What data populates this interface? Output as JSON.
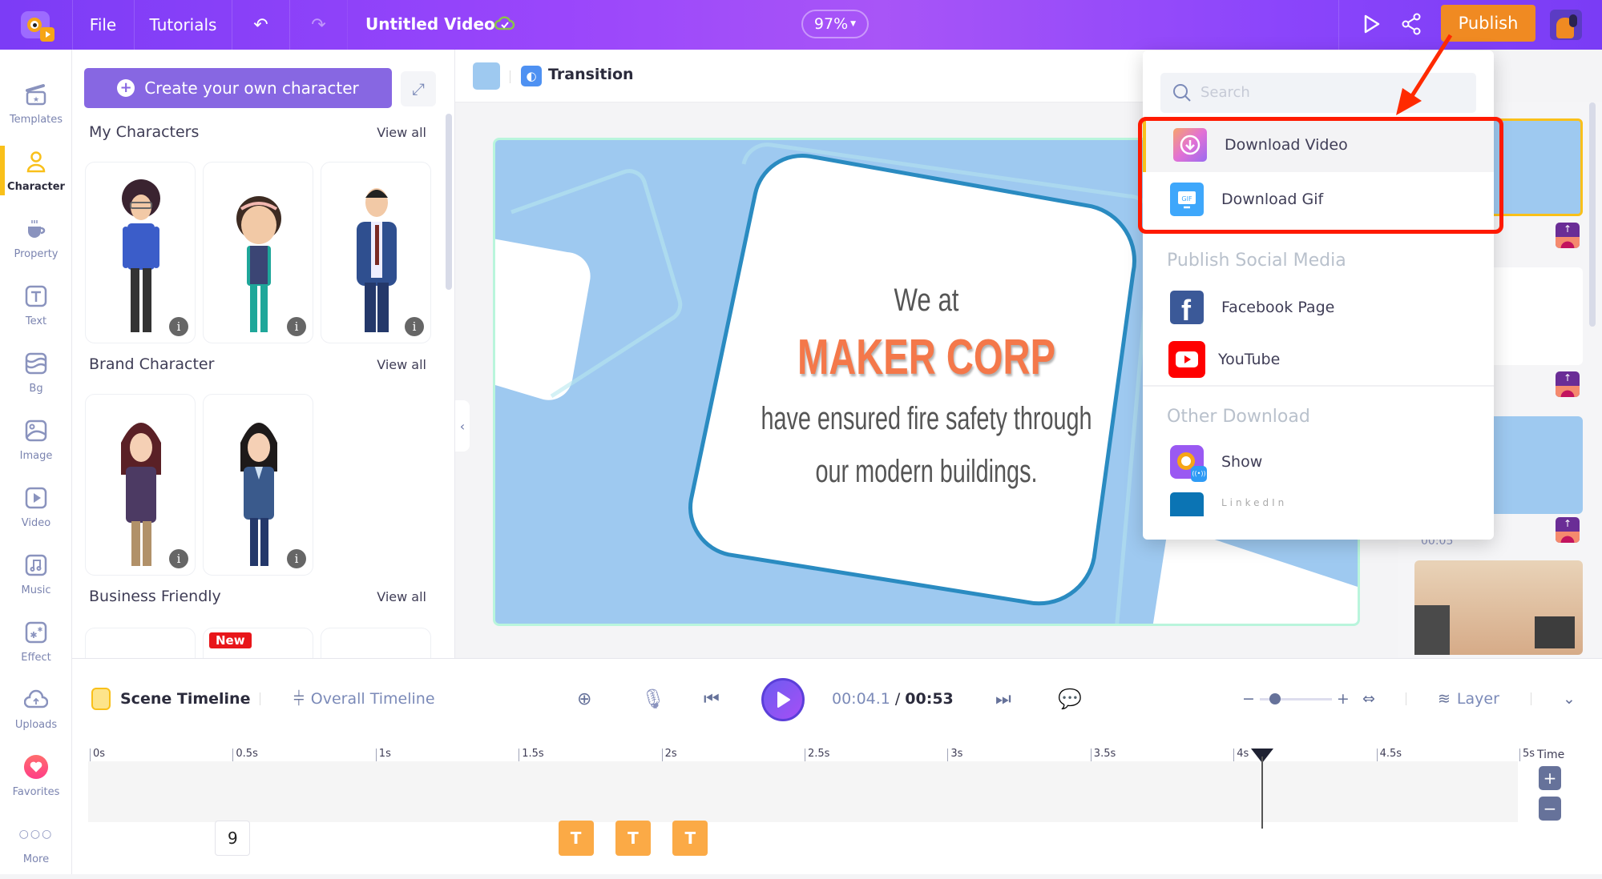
{
  "topbar": {
    "menu": [
      "File",
      "Tutorials"
    ],
    "title": "Untitled Video",
    "zoom": "97%",
    "publish_label": "Publish",
    "icons": {
      "undo": "undo-icon",
      "redo": "redo-icon",
      "cloud": "cloud-saved-icon",
      "preview": "play-preview-icon",
      "share": "share-icon"
    }
  },
  "rail": {
    "items": [
      {
        "label": "Templates",
        "icon": "clapperboard-icon"
      },
      {
        "label": "Character",
        "icon": "person-icon",
        "active": true
      },
      {
        "label": "Property",
        "icon": "cup-icon"
      },
      {
        "label": "Text",
        "icon": "text-icon"
      },
      {
        "label": "Bg",
        "icon": "layers-wave-icon"
      },
      {
        "label": "Image",
        "icon": "image-icon"
      },
      {
        "label": "Video",
        "icon": "video-icon"
      },
      {
        "label": "Music",
        "icon": "music-icon"
      },
      {
        "label": "Effect",
        "icon": "sparkle-icon"
      },
      {
        "label": "Uploads",
        "icon": "cloud-upload-icon"
      },
      {
        "label": "Favorites",
        "icon": "heart-icon"
      },
      {
        "label": "More",
        "icon": "more-dots-icon"
      }
    ],
    "accent": "#f9c01a"
  },
  "panel": {
    "create_label": "Create your own character",
    "sections": [
      {
        "title": "My Characters",
        "view_all": "View all"
      },
      {
        "title": "Brand Character",
        "view_all": "View all"
      },
      {
        "title": "Business Friendly",
        "view_all": "View all"
      }
    ],
    "new_badge": "New",
    "info_glyph": "i"
  },
  "canvas": {
    "transition_label": "Transition",
    "text_line1": "We at",
    "text_brand": "MAKER CORP",
    "text_line2": "have ensured fire safety through",
    "text_line3": "our modern buildings.",
    "brand_color": "#f4784a",
    "bg_color": "#9ec9f0"
  },
  "scenes": {
    "time_label": "00:05"
  },
  "dropdown": {
    "search_placeholder": "Search",
    "items_top": [
      {
        "label": "Download Video",
        "icon": "download-video-icon"
      },
      {
        "label": "Download Gif",
        "icon": "gif-icon"
      }
    ],
    "social_header": "Publish Social Media",
    "social": [
      {
        "label": "Facebook Page",
        "icon": "facebook-icon"
      },
      {
        "label": "YouTube",
        "icon": "youtube-icon"
      }
    ],
    "other_header": "Other Download",
    "other": [
      {
        "label": "Show",
        "icon": "show-app-icon"
      },
      {
        "label": "LinkedIn",
        "icon": "linkedin-icon"
      }
    ]
  },
  "timeline": {
    "scene_tab": "Scene Timeline",
    "overall_tab": "Overall Timeline",
    "current_time": "00:04.1",
    "separator": "/",
    "total_time": "00:53",
    "layer_label": "Layer",
    "time_label": "Time",
    "ticks": [
      "0s",
      "0.5s",
      "1s",
      "1.5s",
      "2s",
      "2.5s",
      "3s",
      "3.5s",
      "4s",
      "4.5s",
      "5s"
    ],
    "playhead_seconds": 4.1,
    "range_seconds": 5,
    "chips": [
      {
        "type": "number",
        "label": "9",
        "at": 0.5
      },
      {
        "type": "text",
        "label": "T",
        "at": 1.7
      },
      {
        "type": "text",
        "label": "T",
        "at": 1.9
      },
      {
        "type": "text",
        "label": "T",
        "at": 2.1
      }
    ],
    "zoom_in": "+",
    "zoom_out": "−"
  }
}
